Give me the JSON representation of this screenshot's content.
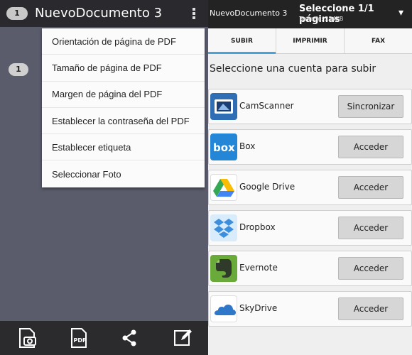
{
  "left": {
    "doc_count": "1",
    "doc_title": "NuevoDocumento 3",
    "page_number": "1",
    "menu": [
      "Orientación de página de PDF",
      "Tamaño de página de PDF",
      "Margen de página del PDF",
      "Establecer la contraseña del PDF",
      "Establecer etiqueta",
      "Seleccionar Foto"
    ]
  },
  "right": {
    "header_title": "NuevoDocumento 3",
    "selection": "Seleccione 1/1 páginas",
    "size": "Tamaño: 224KB",
    "tabs": [
      "SUBIR",
      "IMPRIMIR",
      "FAX"
    ],
    "prompt": "Seleccione una cuenta para subir",
    "accounts": [
      {
        "name": "CamScanner",
        "action": "Sincronizar",
        "icon": "camscanner-icon",
        "color": "#2f6db5"
      },
      {
        "name": "Box",
        "action": "Acceder",
        "icon": "box-icon",
        "color": "#2486d6"
      },
      {
        "name": "Google Drive",
        "action": "Acceder",
        "icon": "google-drive-icon",
        "color": "#34a853"
      },
      {
        "name": "Dropbox",
        "action": "Acceder",
        "icon": "dropbox-icon",
        "color": "#3d8fde"
      },
      {
        "name": "Evernote",
        "action": "Acceder",
        "icon": "evernote-icon",
        "color": "#6aaa3a"
      },
      {
        "name": "SkyDrive",
        "action": "Acceder",
        "icon": "skydrive-icon",
        "color": "#2f77c9"
      }
    ]
  },
  "colors": {
    "accent": "#4aa3d6"
  }
}
